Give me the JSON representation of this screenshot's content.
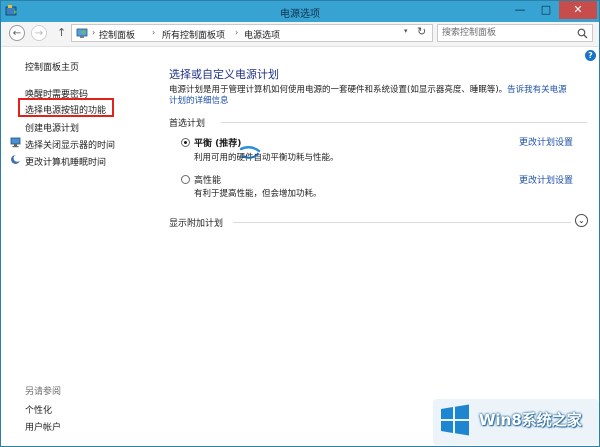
{
  "window": {
    "title": "电源选项",
    "controls": {
      "minimize": "—",
      "maximize": "□",
      "close": "✕"
    }
  },
  "address": {
    "back_glyph": "←",
    "forward_glyph": "→",
    "up_glyph": "↑",
    "breadcrumb": [
      "控制面板",
      "所有控制面板项",
      "电源选项"
    ],
    "separator": "›",
    "dropdown_glyph": "▾",
    "refresh_glyph": "↻",
    "search_placeholder": "搜索控制面板"
  },
  "help_glyph": "?",
  "sidebar": {
    "items": [
      {
        "label": "控制面板主页",
        "icon": ""
      },
      {
        "label": "唤醒时需要密码",
        "icon": ""
      },
      {
        "label": "选择电源按钮的功能",
        "icon": "",
        "highlighted": true
      },
      {
        "label": "创建电源计划",
        "icon": ""
      },
      {
        "label": "选择关闭显示器的时间",
        "icon": "monitor-icon"
      },
      {
        "label": "更改计算机睡眠时间",
        "icon": "moon-icon"
      }
    ],
    "see_also_title": "另请参阅",
    "see_also": [
      "个性化",
      "用户帐户"
    ]
  },
  "main": {
    "heading": "选择或自定义电源计划",
    "description": "电源计划是用于管理计算机如何使用电源的一套硬件和系统设置(如显示器亮度、睡眠等)。",
    "description_link": "告诉我有关电源计划的详细信息",
    "section_label": "首选计划",
    "plans": [
      {
        "name": "平衡 (推荐)",
        "description": "利用可用的硬件自动平衡功耗与性能。",
        "link": "更改计划设置",
        "selected": true
      },
      {
        "name": "高性能",
        "description": "有利于提高性能，但会增加功耗。",
        "link": "更改计划设置",
        "selected": false
      }
    ],
    "extra_plans_label": "显示附加计划",
    "expand_glyph": "⌄"
  },
  "watermark": {
    "text": "Win8系统之家"
  },
  "colors": {
    "titlebar": "#37a3d3",
    "link": "#1e50a8",
    "heading": "#1e3287",
    "highlight": "#e2211a",
    "close": "#c74d4d"
  }
}
